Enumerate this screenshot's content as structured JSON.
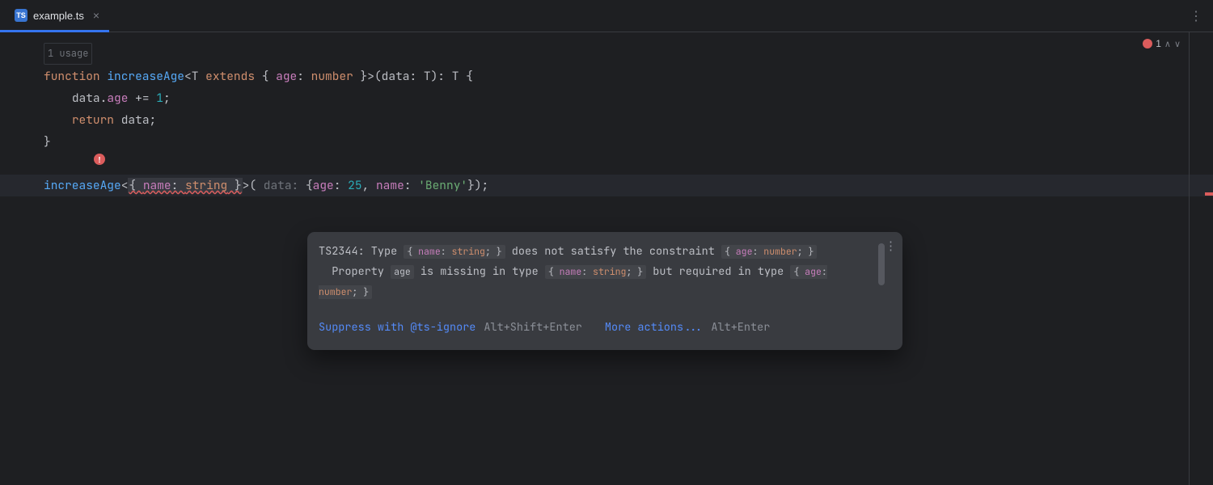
{
  "tab": {
    "icon_text": "TS",
    "filename": "example.ts"
  },
  "status": {
    "error_count": "1"
  },
  "editor": {
    "usage_hint": "1 usage",
    "line1": {
      "kw_function": "function",
      "fn_name": "increaseAge",
      "lt": "<",
      "T": "T",
      "extends": "extends",
      "obrace": " { ",
      "age_prop": "age",
      "colon": ": ",
      "number": "number",
      "cbrace": " }",
      "gt": ">(",
      "param": "data",
      "pcolon": ": ",
      "ptype": "T",
      "close_paren": "): ",
      "ret": "T",
      "end": " {"
    },
    "line2": {
      "indent": "    ",
      "data": "data",
      "dot": ".",
      "age": "age",
      "pluseq": " += ",
      "one": "1",
      "semi": ";"
    },
    "line3": {
      "indent": "    ",
      "return": "return",
      "data": " data",
      "semi": ";"
    },
    "line4": {
      "brace": "}"
    },
    "line6": {
      "call": "increaseAge",
      "lt": "<",
      "err_open": "{ ",
      "err_name": "name",
      "err_colon": ": ",
      "err_string": "string",
      "err_close": " }",
      "gt": ">(",
      "hint_data": " data: ",
      "arg_open": "{",
      "age_prop": "age",
      "age_colon": ": ",
      "age_val": "25",
      "comma": ", ",
      "name_prop": "name",
      "name_colon": ": ",
      "name_val": "'Benny'",
      "arg_close": "});"
    }
  },
  "tooltip": {
    "err_code": "TS2344",
    "l1_a": ": Type ",
    "chip1_a": "{ ",
    "chip1_name": "name",
    "chip1_b": ": ",
    "chip1_string": "string",
    "chip1_c": "; }",
    "l1_b": " does not satisfy the constraint ",
    "chip2_a": "{ ",
    "chip2_age": "age",
    "chip2_b": ": ",
    "chip2_number": "number",
    "chip2_c": "; }",
    "l2_a": "Property ",
    "chip3": "age",
    "l2_b": " is missing in type ",
    "chip4_a": "{ ",
    "chip4_name": "name",
    "chip4_b": ": ",
    "chip4_string": "string",
    "chip4_c": "; }",
    "l2_c": " but required in type ",
    "chip5_a": "{ ",
    "chip5_age": "age",
    "chip5_b": ": ",
    "chip5_number": "number",
    "chip5_c": "; }",
    "action_suppress": "Suppress with @ts-ignore",
    "shortcut_suppress": "Alt+Shift+Enter",
    "action_more": "More actions...",
    "shortcut_more": "Alt+Enter"
  }
}
